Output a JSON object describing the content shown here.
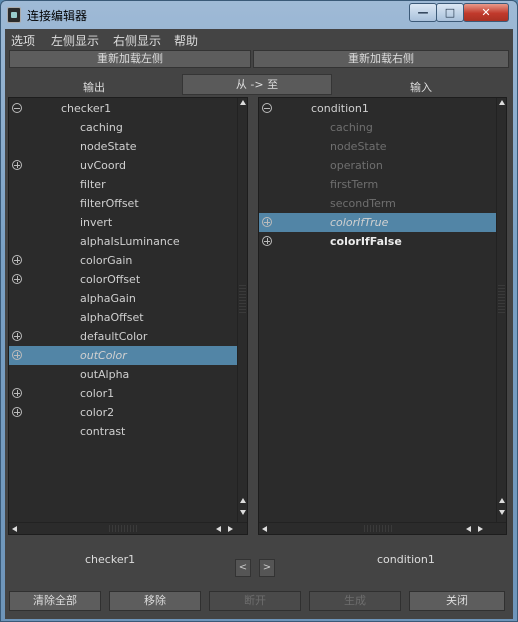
{
  "window": {
    "title": "连接编辑器",
    "min": "—",
    "max": "□",
    "close": "✕"
  },
  "menu": [
    "选项",
    "左侧显示",
    "右侧显示",
    "帮助"
  ],
  "reload": {
    "left": "重新加载左侧",
    "right": "重新加载右侧"
  },
  "headers": {
    "output": "输出",
    "direction": "从 -> 至",
    "input": "输入"
  },
  "left_list": [
    {
      "label": "checker1",
      "indent": 0,
      "icon": "minus",
      "style": "normal"
    },
    {
      "label": "caching",
      "indent": 1,
      "icon": "",
      "style": "normal"
    },
    {
      "label": "nodeState",
      "indent": 1,
      "icon": "",
      "style": "normal"
    },
    {
      "label": "uvCoord",
      "indent": 1,
      "icon": "plus",
      "style": "normal"
    },
    {
      "label": "filter",
      "indent": 1,
      "icon": "",
      "style": "normal"
    },
    {
      "label": "filterOffset",
      "indent": 1,
      "icon": "",
      "style": "normal"
    },
    {
      "label": "invert",
      "indent": 1,
      "icon": "",
      "style": "normal"
    },
    {
      "label": "alphaIsLuminance",
      "indent": 1,
      "icon": "",
      "style": "normal"
    },
    {
      "label": "colorGain",
      "indent": 1,
      "icon": "plus",
      "style": "normal"
    },
    {
      "label": "colorOffset",
      "indent": 1,
      "icon": "plus",
      "style": "normal"
    },
    {
      "label": "alphaGain",
      "indent": 1,
      "icon": "",
      "style": "normal"
    },
    {
      "label": "alphaOffset",
      "indent": 1,
      "icon": "",
      "style": "normal"
    },
    {
      "label": "defaultColor",
      "indent": 1,
      "icon": "plus",
      "style": "normal"
    },
    {
      "label": "outColor",
      "indent": 1,
      "icon": "plus",
      "style": "selected-italic"
    },
    {
      "label": "outAlpha",
      "indent": 1,
      "icon": "",
      "style": "normal"
    },
    {
      "label": "color1",
      "indent": 1,
      "icon": "plus",
      "style": "normal"
    },
    {
      "label": "color2",
      "indent": 1,
      "icon": "plus",
      "style": "normal"
    },
    {
      "label": "contrast",
      "indent": 1,
      "icon": "",
      "style": "normal"
    }
  ],
  "right_list": [
    {
      "label": "condition1",
      "indent": 0,
      "icon": "minus",
      "style": "normal"
    },
    {
      "label": "caching",
      "indent": 1,
      "icon": "",
      "style": "dim"
    },
    {
      "label": "nodeState",
      "indent": 1,
      "icon": "",
      "style": "dim"
    },
    {
      "label": "operation",
      "indent": 1,
      "icon": "",
      "style": "dim"
    },
    {
      "label": "firstTerm",
      "indent": 1,
      "icon": "",
      "style": "dim"
    },
    {
      "label": "secondTerm",
      "indent": 1,
      "icon": "",
      "style": "dim"
    },
    {
      "label": "colorIfTrue",
      "indent": 1,
      "icon": "plus",
      "style": "selected-italic"
    },
    {
      "label": "colorIfFalse",
      "indent": 1,
      "icon": "plus",
      "style": "bold"
    }
  ],
  "footer": {
    "left_node": "checker1",
    "right_node": "condition1",
    "prev": "<",
    "next": ">"
  },
  "buttons": [
    {
      "label": "清除全部",
      "enabled": true
    },
    {
      "label": "移除",
      "enabled": true
    },
    {
      "label": "断开",
      "enabled": false
    },
    {
      "label": "生成",
      "enabled": false
    },
    {
      "label": "关闭",
      "enabled": true
    }
  ]
}
